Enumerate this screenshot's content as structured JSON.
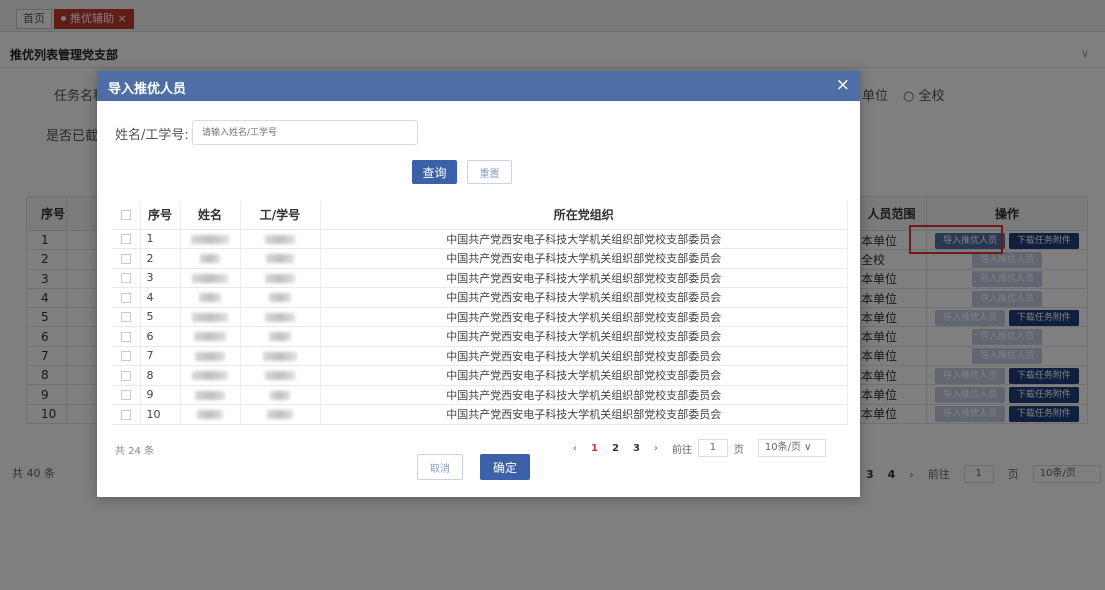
{
  "tabs": [
    {
      "label": "首页"
    },
    {
      "label": "推优辅助 ×"
    }
  ],
  "panel": {
    "title": "推优列表管理党支部",
    "collapse_icon": "chevron-down-icon"
  },
  "filter_bg": {
    "task_name_label": "任务名称",
    "deadline_label": "是否已截止",
    "unit_label": "单位",
    "school_option": "全校"
  },
  "bg_table": {
    "headers": {
      "index": "序号",
      "scope": "人员范围",
      "ops": "操作"
    },
    "rows": [
      {
        "idx": "1",
        "scope": "本单位",
        "import": "导入推优人员",
        "download": "下载任务附件",
        "import_enabled": true,
        "has_download": true
      },
      {
        "idx": "2",
        "scope": "全校",
        "import": "导入推优人员",
        "download": "",
        "import_enabled": false,
        "has_download": false
      },
      {
        "idx": "3",
        "scope": "本单位",
        "import": "导入推优人员",
        "download": "",
        "import_enabled": false,
        "has_download": false
      },
      {
        "idx": "4",
        "scope": "本单位",
        "import": "导入推优人员",
        "download": "",
        "import_enabled": false,
        "has_download": false
      },
      {
        "idx": "5",
        "scope": "本单位",
        "import": "导入推优人员",
        "download": "下载任务附件",
        "import_enabled": false,
        "has_download": true
      },
      {
        "idx": "6",
        "scope": "本单位",
        "import": "导入推优人员",
        "download": "",
        "import_enabled": false,
        "has_download": false
      },
      {
        "idx": "7",
        "scope": "本单位",
        "import": "导入推优人员",
        "download": "",
        "import_enabled": false,
        "has_download": false
      },
      {
        "idx": "8",
        "scope": "本单位",
        "import": "导入推优人员",
        "download": "下载任务附件",
        "import_enabled": false,
        "has_download": true
      },
      {
        "idx": "9",
        "scope": "本单位",
        "import": "导入推优人员",
        "download": "下载任务附件",
        "import_enabled": false,
        "has_download": true
      },
      {
        "idx": "10",
        "scope": "本单位",
        "import": "导入推优人员",
        "download": "下载任务附件",
        "import_enabled": false,
        "has_download": true
      }
    ],
    "total": "共 40 条",
    "pager": {
      "pages": [
        "3",
        "4"
      ],
      "next": "›",
      "goto_label": "前往",
      "page_value": "1",
      "page_suffix": "页",
      "size": "10条/页"
    }
  },
  "modal": {
    "title": "导入推优人员",
    "close": "×",
    "search_label": "姓名/工学号:",
    "search_placeholder": "请输入姓名/工学号",
    "query_button": "查询",
    "reset_button": "重置",
    "headers": {
      "index": "序号",
      "name": "姓名",
      "id": "工/学号",
      "org": "所在党组织"
    },
    "rows": [
      {
        "idx": "1",
        "org": "中国共产党西安电子科技大学机关组织部党校支部委员会"
      },
      {
        "idx": "2",
        "org": "中国共产党西安电子科技大学机关组织部党校支部委员会"
      },
      {
        "idx": "3",
        "org": "中国共产党西安电子科技大学机关组织部党校支部委员会"
      },
      {
        "idx": "4",
        "org": "中国共产党西安电子科技大学机关组织部党校支部委员会"
      },
      {
        "idx": "5",
        "org": "中国共产党西安电子科技大学机关组织部党校支部委员会"
      },
      {
        "idx": "6",
        "org": "中国共产党西安电子科技大学机关组织部党校支部委员会"
      },
      {
        "idx": "7",
        "org": "中国共产党西安电子科技大学机关组织部党校支部委员会"
      },
      {
        "idx": "8",
        "org": "中国共产党西安电子科技大学机关组织部党校支部委员会"
      },
      {
        "idx": "9",
        "org": "中国共产党西安电子科技大学机关组织部党校支部委员会"
      },
      {
        "idx": "10",
        "org": "中国共产党西安电子科技大学机关组织部党校支部委员会"
      }
    ],
    "total": "共 24 条",
    "pager": {
      "prev": "‹",
      "pages": [
        "1",
        "2",
        "3"
      ],
      "current": "1",
      "next": "›",
      "goto_label": "前往",
      "page_value": "1",
      "page_suffix": "页",
      "size": "10条/页 ∨"
    },
    "cancel_button": "取消",
    "ok_button": "确定"
  }
}
